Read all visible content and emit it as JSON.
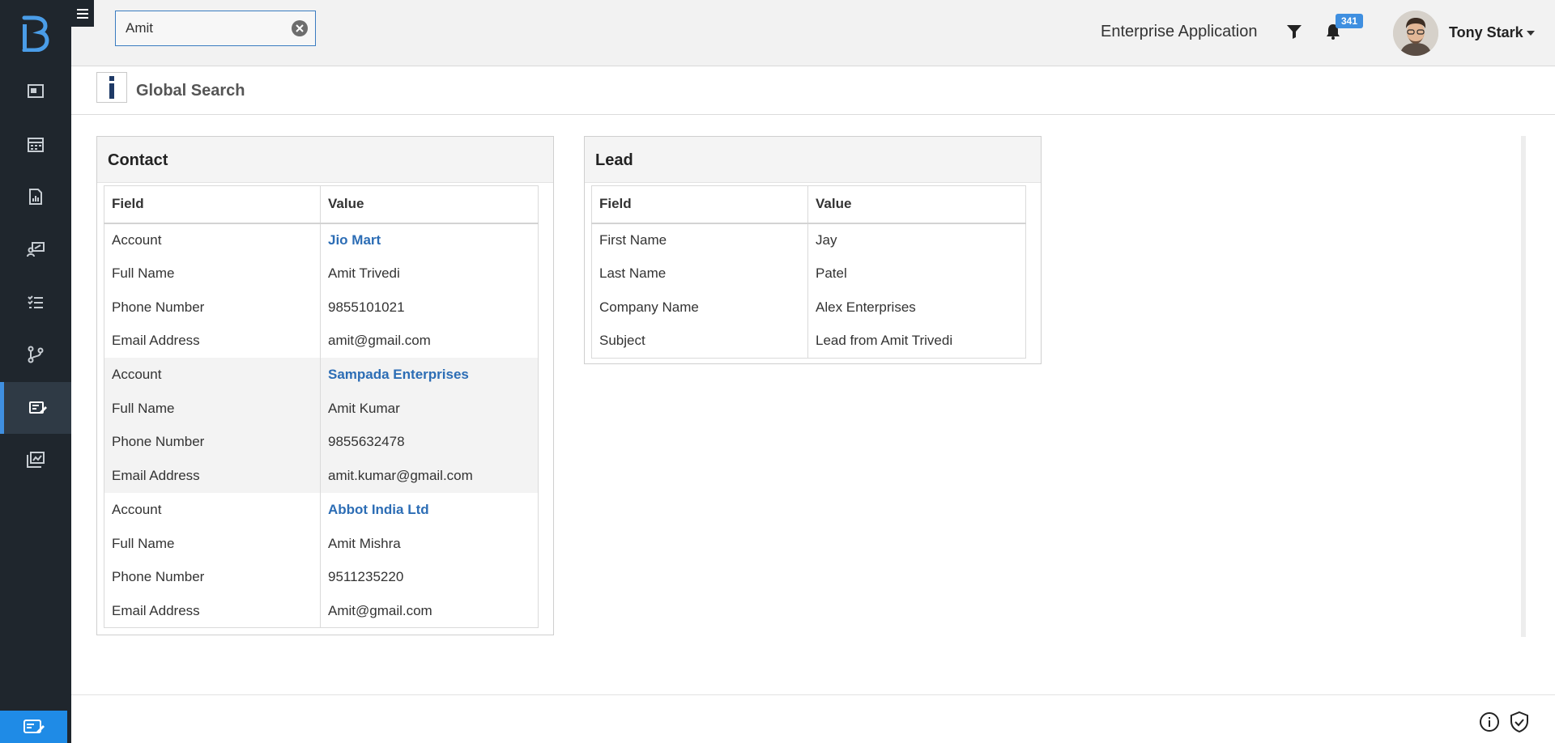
{
  "topbar": {
    "search_value": "Amit",
    "app_title": "Enterprise Application",
    "notification_count": "341",
    "user_name": "Tony Stark"
  },
  "page": {
    "title": "Global Search"
  },
  "contact": {
    "title": "Contact",
    "headers": [
      "Field",
      "Value"
    ],
    "rows": [
      {
        "field": "Account",
        "value": "Jio Mart"
      },
      {
        "field": "Full Name",
        "value": "Amit Trivedi"
      },
      {
        "field": "Phone Number",
        "value": "9855101021"
      },
      {
        "field": "Email Address",
        "value": "amit@gmail.com"
      },
      {
        "field": "Account",
        "value": "Sampada Enterprises"
      },
      {
        "field": "Full Name",
        "value": "Amit Kumar"
      },
      {
        "field": "Phone Number",
        "value": "9855632478"
      },
      {
        "field": "Email Address",
        "value": "amit.kumar@gmail.com"
      },
      {
        "field": "Account",
        "value": "Abbot India Ltd"
      },
      {
        "field": "Full Name",
        "value": "Amit Mishra"
      },
      {
        "field": "Phone Number",
        "value": "9511235220"
      },
      {
        "field": "Email Address",
        "value": "Amit@gmail.com"
      }
    ]
  },
  "lead": {
    "title": "Lead",
    "headers": [
      "Field",
      "Value"
    ],
    "rows": [
      {
        "field": "First Name",
        "value": "Jay"
      },
      {
        "field": "Last Name",
        "value": "Patel"
      },
      {
        "field": "Company Name",
        "value": "Alex Enterprises"
      },
      {
        "field": "Subject",
        "value": "Lead from Amit Trivedi"
      }
    ]
  },
  "icons": {
    "sidebar": [
      "dashboard-icon",
      "calendar-icon",
      "report-icon",
      "presentation-icon",
      "checklist-icon",
      "branch-icon",
      "edit-form-icon",
      "board-icon"
    ],
    "active_sidebar": "edit-form-icon"
  },
  "colors": {
    "sidebar_bg": "#1f262d",
    "accent": "#3f8fe0",
    "link": "#2c6db5"
  }
}
